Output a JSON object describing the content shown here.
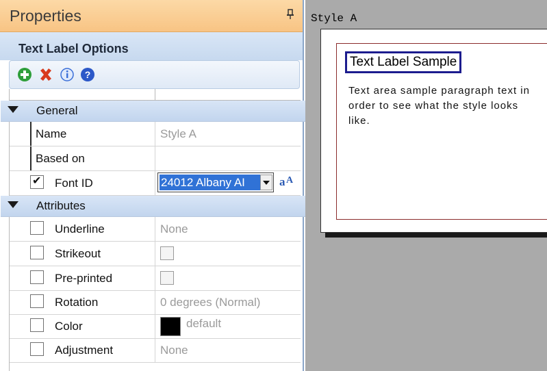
{
  "panel": {
    "title": "Properties",
    "pin_glyph": "▄"
  },
  "section": {
    "title": "Text Label Options"
  },
  "toolbar": {
    "buttons": [
      {
        "name": "add",
        "icon": "add-icon",
        "color": "#2e9e3a"
      },
      {
        "name": "delete",
        "icon": "delete-icon",
        "color": "#d83a1c"
      },
      {
        "name": "info",
        "icon": "info-icon",
        "color": "#3a6fd8"
      },
      {
        "name": "help",
        "icon": "help-icon",
        "color": "#2c58c8"
      }
    ]
  },
  "categories": {
    "general": "General",
    "attributes": "Attributes"
  },
  "general": {
    "name_label": "Name",
    "name_value": "Style A",
    "based_on_label": "Based on",
    "based_on_value": "",
    "font_id_label": "Font ID",
    "font_id_checked": true,
    "font_id_value": "24012 Albany AI"
  },
  "attributes": {
    "underline_label": "Underline",
    "underline_value": "None",
    "strikeout_label": "Strikeout",
    "preprinted_label": "Pre-printed",
    "rotation_label": "Rotation",
    "rotation_value": "0 degrees (Normal)",
    "color_label": "Color",
    "color_value": "default",
    "color_swatch": "#000000",
    "adjustment_label": "Adjustment",
    "adjustment_value": "None"
  },
  "preview": {
    "caption": "Style A",
    "sample_title": "Text Label Sample",
    "sample_paragraph": "Text area sample paragraph text in order to see what the style looks like."
  }
}
